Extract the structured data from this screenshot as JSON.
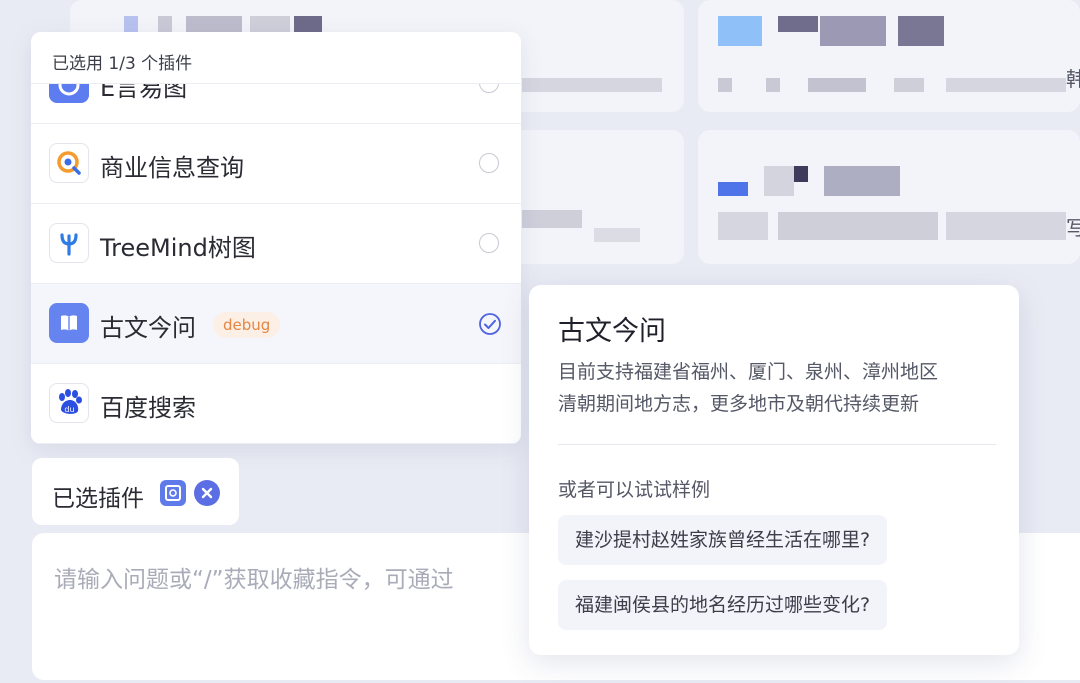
{
  "plugin_panel": {
    "header": "已选用 1/3 个插件",
    "plugins": [
      {
        "name": "E言易图",
        "icon": "chart-icon",
        "selected": false,
        "badge": ""
      },
      {
        "name": "商业信息查询",
        "icon": "business-search-icon",
        "selected": false,
        "badge": ""
      },
      {
        "name": "TreeMind树图",
        "icon": "treemind-icon",
        "selected": false,
        "badge": ""
      },
      {
        "name": "古文今问",
        "icon": "book-icon",
        "selected": true,
        "badge": "debug"
      },
      {
        "name": "百度搜索",
        "icon": "baidu-paw-icon",
        "selected": false,
        "badge": ""
      }
    ]
  },
  "selected_bar": {
    "label": "已选插件"
  },
  "input": {
    "placeholder": "请输入问题或“/”获取收藏指令，可通过"
  },
  "popover": {
    "title": "古文今问",
    "description_lines": [
      "目前支持福建省福州、厦门、泉州、漳州地区",
      "清朝期间地方志，更多地市及朝代持续更新"
    ],
    "hint": "或者可以试试样例",
    "examples": [
      "建沙提村赵姓家族曾经生活在哪里?",
      "福建闽侯县的地名经历过哪些变化?"
    ]
  },
  "background": {
    "partial_texts": [
      "韩",
      "写"
    ]
  },
  "colors": {
    "accent": "#5b6ee3",
    "badge_bg": "#fcefe6",
    "badge_text": "#e38743",
    "row_active": "#f5f6fb"
  }
}
